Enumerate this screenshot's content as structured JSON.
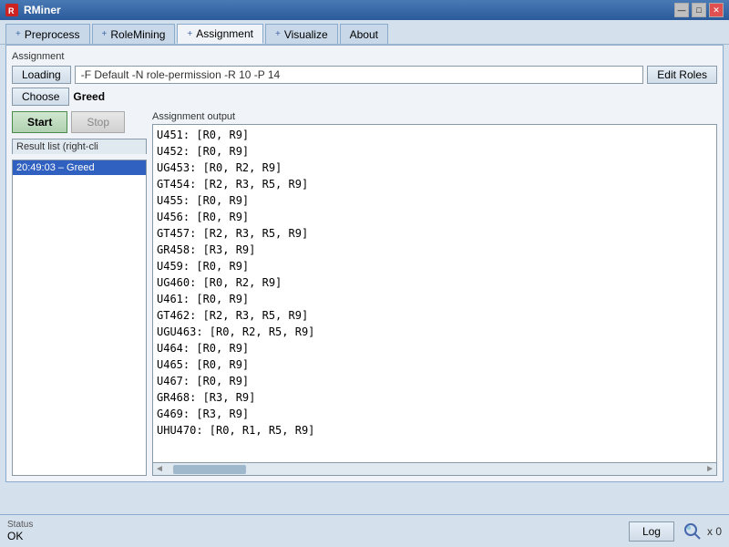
{
  "titleBar": {
    "title": "RMiner",
    "icon": "R",
    "controls": {
      "minimize": "—",
      "maximize": "□",
      "close": "✕"
    }
  },
  "tabs": [
    {
      "label": "Preprocess",
      "icon": "+",
      "active": false
    },
    {
      "label": "RoleMining",
      "icon": "+",
      "active": false
    },
    {
      "label": "Assignment",
      "icon": "+",
      "active": true
    },
    {
      "label": "Visualize",
      "icon": "+",
      "active": false
    },
    {
      "label": "About",
      "icon": "",
      "active": false
    }
  ],
  "assignment": {
    "sectionLabel": "Assignment",
    "loadingBtn": "Loading",
    "commandText": "-F Default  -N role-permission  -R 10  -P 14",
    "editRolesBtn": "Edit Roles",
    "chooseBtn": "Choose",
    "chooseValue": "Greed",
    "startBtn": "Start",
    "stopBtn": "Stop",
    "resultListLabel": "Result list (right-cli",
    "resultItems": [
      {
        "time": "20:49:03",
        "label": "Greed",
        "selected": true
      }
    ],
    "outputLabel": "Assignment output",
    "outputLines": [
      "U451:  [R0, R9]",
      "U452:  [R0, R9]",
      "UG453: [R0, R2, R9]",
      "GT454: [R2, R3, R5, R9]",
      "U455:  [R0, R9]",
      "U456:  [R0, R9]",
      "GT457: [R2, R3, R5, R9]",
      "GR458: [R3, R9]",
      "U459:  [R0, R9]",
      "UG460: [R0, R2, R9]",
      "U461:  [R0, R9]",
      "GT462: [R2, R3, R5, R9]",
      "UGU463: [R0, R2, R5, R9]",
      "U464:  [R0, R9]",
      "U465:  [R0, R9]",
      "U467:  [R0, R9]",
      "GR468: [R3, R9]",
      "G469:  [R3, R9]",
      "UHU470: [R0, R1, R5, R9]"
    ]
  },
  "statusBar": {
    "statusTitle": "Status",
    "statusValue": "OK",
    "logBtn": "Log",
    "xCount": "x 0"
  }
}
